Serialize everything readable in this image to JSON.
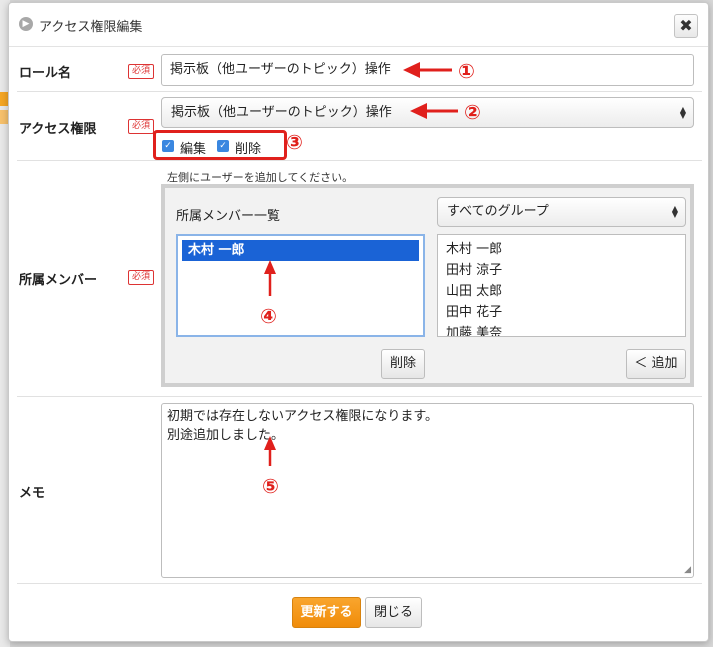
{
  "dialog": {
    "title": "アクセス権限編集",
    "close_glyph": "✖"
  },
  "role": {
    "label": "ロール名",
    "required": "必須",
    "value": "掲示板（他ユーザーのトピック）操作"
  },
  "access": {
    "label": "アクセス権限",
    "required": "必須",
    "selected": "掲示板（他ユーザーのトピック）操作",
    "checkboxes": [
      {
        "label": "編集",
        "checked": true
      },
      {
        "label": "削除",
        "checked": true
      }
    ]
  },
  "members": {
    "label": "所属メンバー",
    "required": "必須",
    "hint": "左側にユーザーを追加してください。",
    "list_title": "所属メンバー一覧",
    "group_select": "すべてのグループ",
    "assigned": [
      "木村 一郎"
    ],
    "available": [
      "木村 一郎",
      "田村 涼子",
      "山田 太郎",
      "田中 花子",
      "加藤 美奈"
    ],
    "delete_button": "削除",
    "add_button": "＜ 追加"
  },
  "memo": {
    "label": "メモ",
    "value": "初期では存在しないアクセス権限になります。\n別途追加しました。"
  },
  "footer": {
    "update_button": "更新する",
    "close_button": "閉じる"
  },
  "annotations": {
    "n1": "①",
    "n2": "②",
    "n3": "③",
    "n4": "④",
    "n5": "⑤",
    "color": "#e0201c"
  }
}
